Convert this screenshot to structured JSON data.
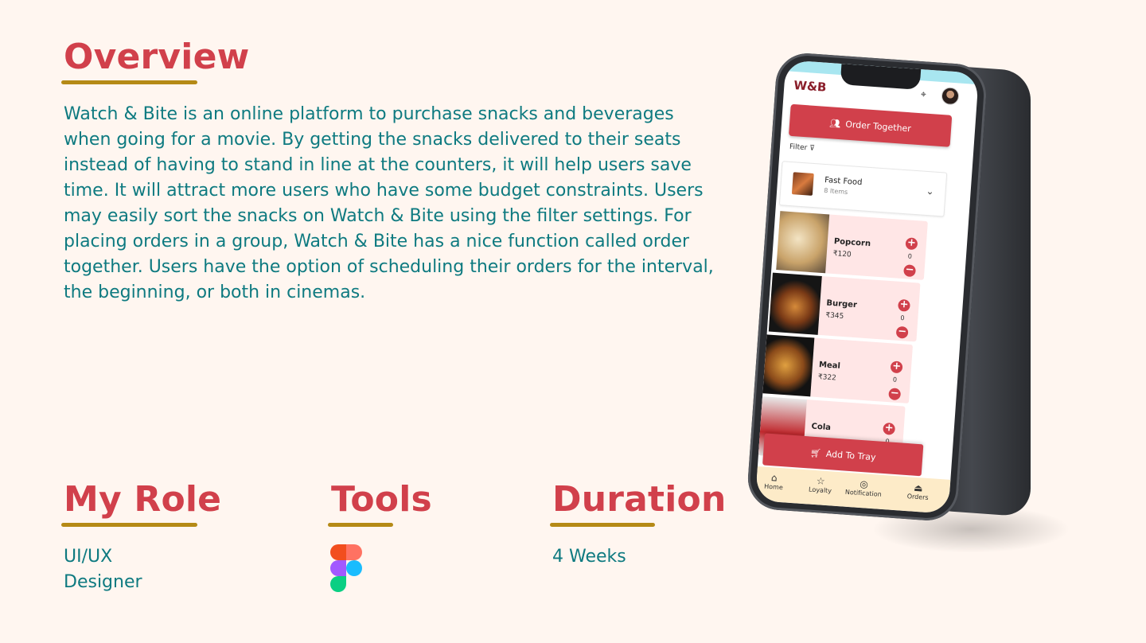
{
  "sections": {
    "overview": {
      "heading": "Overview",
      "text": "Watch & Bite is an online platform to purchase snacks and beverages when going for a movie. By getting the snacks delivered to their seats instead of having to stand in line at the counters, it will help users save time. It will attract more users who have some budget constraints. Users may easily sort the snacks on Watch & Bite using the filter settings. For placing orders in a group, Watch & Bite has a nice function called order together. Users have the option of scheduling their orders for the interval, the beginning, or both in cinemas."
    },
    "role": {
      "heading": "My Role",
      "value": "UI/UX\nDesigner"
    },
    "tools": {
      "heading": "Tools",
      "icon": "figma-icon"
    },
    "duration": {
      "heading": "Duration",
      "value": "4 Weeks"
    }
  },
  "colors": {
    "background": "#fff6f0",
    "heading": "#d1404b",
    "underline": "#b58a16",
    "body_text": "#0e7a80",
    "app_accent": "#d1404b",
    "app_nav": "#fdebc8"
  },
  "phone": {
    "logo": "W&B",
    "order_together": "Order Together",
    "filter": "Filter",
    "category": {
      "name": "Fast Food",
      "count": "8 Items"
    },
    "items": [
      {
        "name": "Popcorn",
        "price": "₹120",
        "qty": "0"
      },
      {
        "name": "Burger",
        "price": "₹345",
        "qty": "0"
      },
      {
        "name": "Meal",
        "price": "₹322",
        "qty": "0"
      },
      {
        "name": "Cola",
        "price": "",
        "qty": "0"
      }
    ],
    "add_to_tray": "Add To Tray",
    "nav": [
      {
        "label": "Home",
        "icon": "home-icon"
      },
      {
        "label": "Loyalty",
        "icon": "star-icon"
      },
      {
        "label": "Notification",
        "icon": "notification-icon"
      },
      {
        "label": "Orders",
        "icon": "cloche-icon"
      }
    ]
  }
}
